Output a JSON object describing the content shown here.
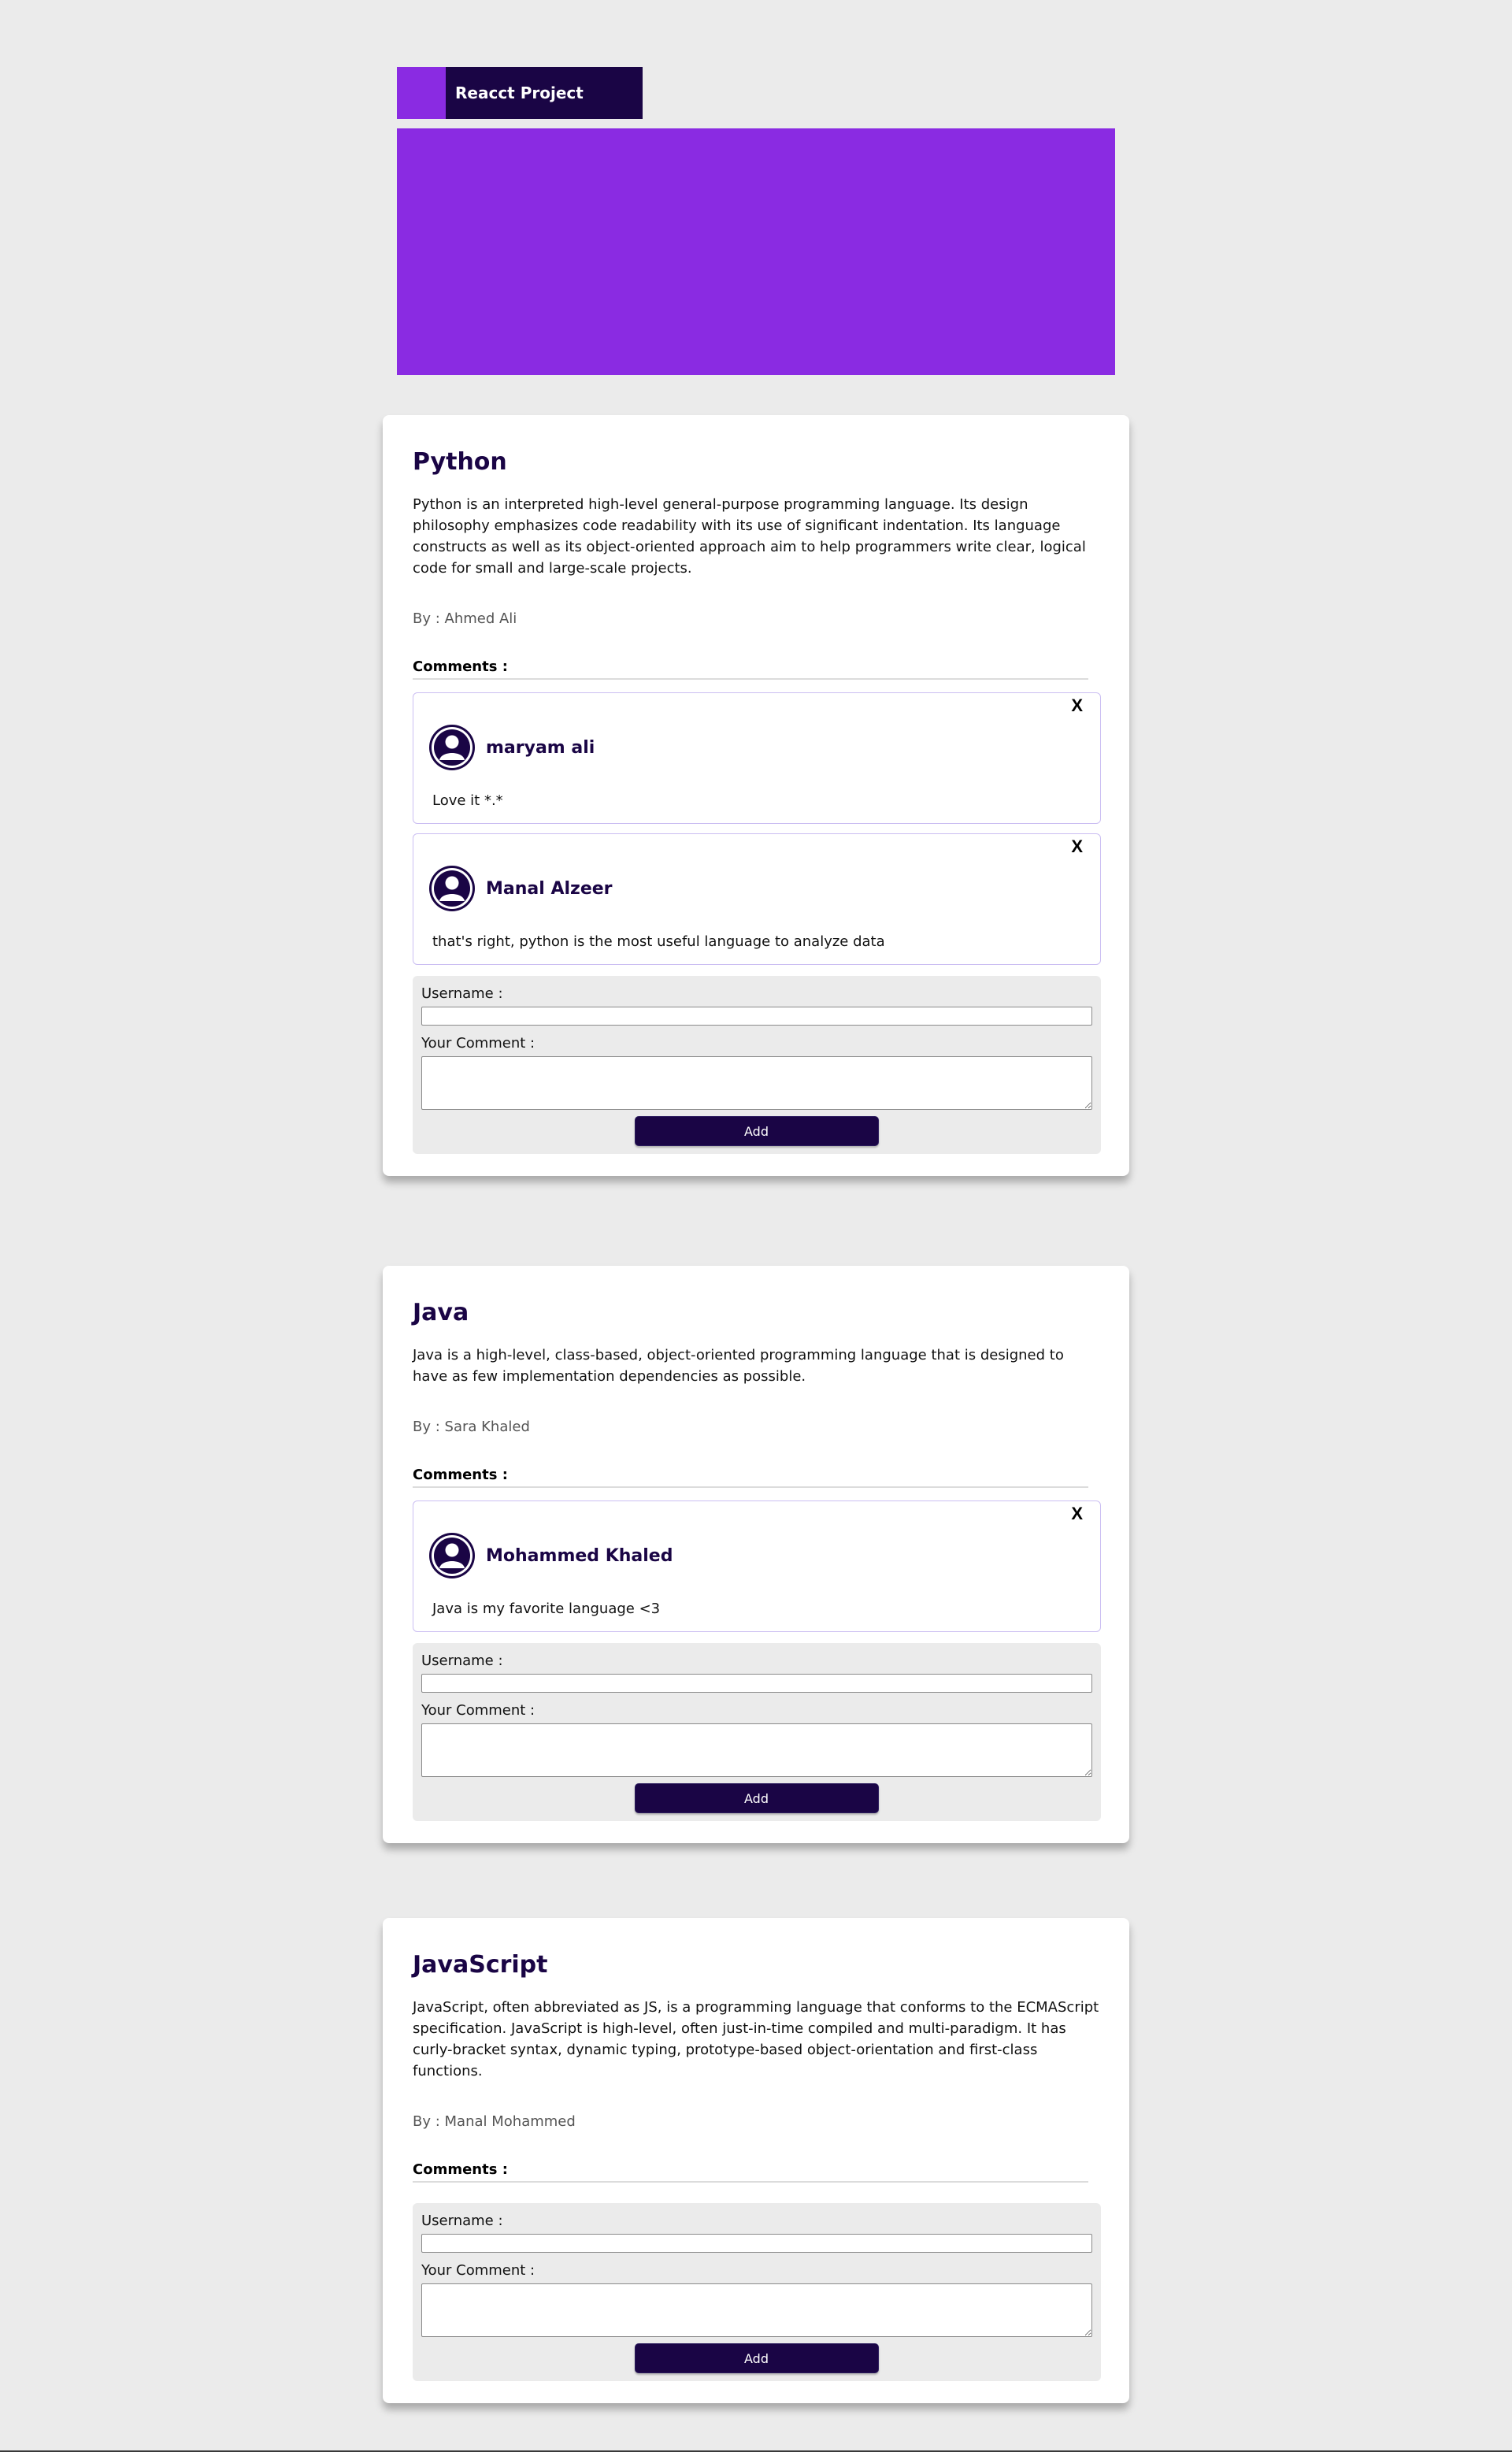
{
  "header": {
    "title": "Reacct Project"
  },
  "colors": {
    "accent": "#8a2be2",
    "dark": "#1a0545",
    "background": "#ebebeb"
  },
  "posts": [
    {
      "title": "Python",
      "body": "Python is an interpreted high-level general-purpose programming language. Its design philosophy emphasizes code readability with its use of significant indentation. Its language constructs as well as its object-oriented approach aim to help programmers write clear, logical code for small and large-scale projects.",
      "author_label": "By : ",
      "author": "Ahmed Ali",
      "comments_heading": "Comments :",
      "comments": [
        {
          "user": "maryam ali",
          "text": "Love it *.*",
          "delete_label": "X",
          "avatar_icon": "user-avatar-icon"
        },
        {
          "user": "Manal Alzeer",
          "text": "that's right, python is the most useful language to analyze data",
          "delete_label": "X",
          "avatar_icon": "user-avatar-icon"
        }
      ],
      "form": {
        "username_label": "Username :",
        "username_value": "",
        "comment_label": "Your Comment :",
        "comment_value": "",
        "add_label": "Add"
      }
    },
    {
      "title": "Java",
      "body": "Java is a high-level, class-based, object-oriented programming language that is designed to have as few implementation dependencies as possible.",
      "author_label": "By : ",
      "author": "Sara Khaled",
      "comments_heading": "Comments :",
      "comments": [
        {
          "user": "Mohammed Khaled",
          "text": "Java is my favorite language <3",
          "delete_label": "X",
          "avatar_icon": "user-avatar-icon"
        }
      ],
      "form": {
        "username_label": "Username :",
        "username_value": "",
        "comment_label": "Your Comment :",
        "comment_value": "",
        "add_label": "Add"
      }
    },
    {
      "title": "JavaScript",
      "body": "JavaScript, often abbreviated as JS, is a programming language that conforms to the ECMAScript specification. JavaScript is high-level, often just-in-time compiled and multi-paradigm. It has curly-bracket syntax, dynamic typing, prototype-based object-orientation and first-class functions.",
      "author_label": "By : ",
      "author": "Manal Mohammed",
      "comments_heading": "Comments :",
      "comments": [],
      "form": {
        "username_label": "Username :",
        "username_value": "",
        "comment_label": "Your Comment :",
        "comment_value": "",
        "add_label": "Add"
      }
    }
  ]
}
